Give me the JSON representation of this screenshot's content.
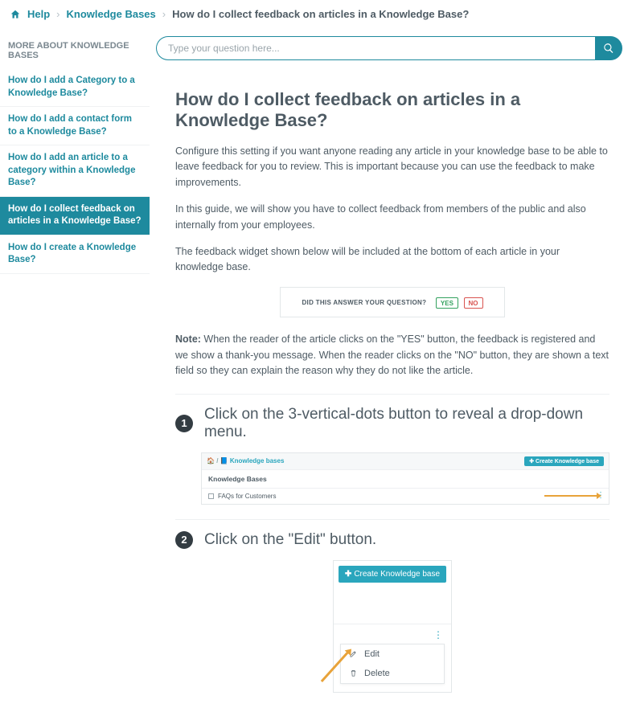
{
  "breadcrumb": {
    "help": "Help",
    "section": "Knowledge Bases",
    "current": "How do I collect feedback on articles in a Knowledge Base?"
  },
  "sidebar": {
    "heading": "MORE ABOUT KNOWLEDGE BASES",
    "items": [
      {
        "label": "How do I add a Category to a Knowledge Base?"
      },
      {
        "label": "How do I add a contact form to a Knowledge Base?"
      },
      {
        "label": "How do I add an article to a category within a Knowledge Base?"
      },
      {
        "label": "How do I collect feedback on articles in a Knowledge Base?"
      },
      {
        "label": "How do I create a Knowledge Base?"
      }
    ]
  },
  "search": {
    "placeholder": "Type your question here..."
  },
  "article": {
    "title": "How do I collect feedback on articles in a Knowledge Base?",
    "p1": "Configure this setting if you want anyone reading any article in your knowledge base to be able to leave feedback for you to review. This is important because you can use the feedback to make improvements.",
    "p2": "In this guide, we will show you have to collect feedback from members of the public and also internally from your employees.",
    "p3": "The feedback widget shown below will be included at the bottom of each article in your knowledge base.",
    "widget": {
      "question": "DID THIS ANSWER YOUR QUESTION?",
      "yes": "YES",
      "no": "NO"
    },
    "note_label": "Note:",
    "note_text": " When the reader of the article clicks on the \"YES\" button, the feedback is registered and we show a thank-you message. When the reader clicks on the \"NO\" button, they are shown a text field so they can explain the reason why they do not like the article.",
    "steps": [
      {
        "num": "1",
        "title": "Click on the 3-vertical-dots button to reveal a drop-down menu."
      },
      {
        "num": "2",
        "title": "Click on the \"Edit\" button."
      }
    ],
    "ill1": {
      "crumb_home": "🏠",
      "crumb_sep": " / ",
      "crumb_section": "Knowledge bases",
      "create": "Create Knowledge base",
      "heading": "Knowledge Bases",
      "row": "FAQs for Customers"
    },
    "ill2": {
      "create": "Create Knowledge base",
      "edit": "Edit",
      "delete": "Delete"
    }
  }
}
